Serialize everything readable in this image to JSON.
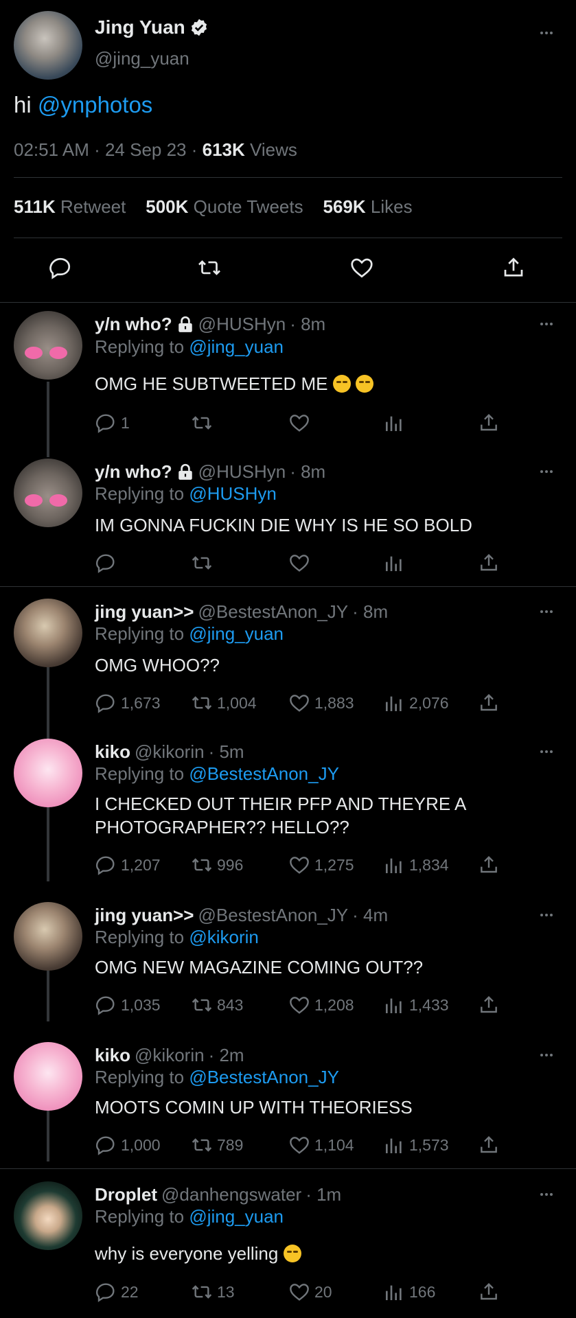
{
  "main_tweet": {
    "name": "Jing Yuan",
    "handle": "@jing_yuan",
    "text_prefix": "hi",
    "mention": "@ynphotos",
    "time": "02:51 AM · 24 Sep 23 ·",
    "views_count": "613K",
    "views_label": "Views",
    "retweets_count": "511K",
    "retweets_label": "Retweet",
    "quotes_count": "500K",
    "quotes_label": "Quote Tweets",
    "likes_count": "569K",
    "likes_label": "Likes"
  },
  "replies": [
    {
      "name": "y/n who?",
      "locked": true,
      "handle": "@HUSHyn",
      "time": "· 8m",
      "reply_prefix": "Replying to",
      "reply_to": "@jing_yuan",
      "lines": [
        "OMG HE SUBTWEETED ME"
      ],
      "emoji_count": 2,
      "replies": "1",
      "retweets": "",
      "likes": "",
      "views": ""
    },
    {
      "name": "y/n who?",
      "locked": true,
      "handle": "@HUSHyn",
      "time": "· 8m",
      "reply_prefix": "Replying to",
      "reply_to": "@HUSHyn",
      "lines": [
        "IM GONNA FUCKIN DIE WHY IS HE SO BOLD"
      ],
      "emoji_count": 0,
      "replies": "",
      "retweets": "",
      "likes": "",
      "views": ""
    },
    {
      "name": "jing yuan>>",
      "locked": false,
      "handle": "@BestestAnon_JY",
      "time": "· 8m",
      "reply_prefix": "Replying to",
      "reply_to": "@jing_yuan",
      "lines": [
        "OMG WHOO??"
      ],
      "emoji_count": 0,
      "replies": "1,673",
      "retweets": "1,004",
      "likes": "1,883",
      "views": "2,076"
    },
    {
      "name": "kiko",
      "locked": false,
      "handle": "@kikorin",
      "time": "· 5m",
      "reply_prefix": "Replying to",
      "reply_to": "@BestestAnon_JY",
      "lines": [
        "I CHECKED OUT THEIR PFP AND THEYRE A",
        "PHOTOGRAPHER?? HELLO??"
      ],
      "emoji_count": 0,
      "replies": "1,207",
      "retweets": "996",
      "likes": "1,275",
      "views": "1,834"
    },
    {
      "name": "jing yuan>>",
      "locked": false,
      "handle": "@BestestAnon_JY",
      "time": "· 4m",
      "reply_prefix": "Replying to",
      "reply_to": "@kikorin",
      "lines": [
        "OMG NEW MAGAZINE COMING OUT??"
      ],
      "emoji_count": 0,
      "replies": "1,035",
      "retweets": "843",
      "likes": "1,208",
      "views": "1,433"
    },
    {
      "name": "kiko",
      "locked": false,
      "handle": "@kikorin",
      "time": "· 2m",
      "reply_prefix": "Replying to",
      "reply_to": "@BestestAnon_JY",
      "lines": [
        "MOOTS COMIN UP WITH THEORIESS"
      ],
      "emoji_count": 0,
      "replies": "1,000",
      "retweets": "789",
      "likes": "1,104",
      "views": "1,573"
    },
    {
      "name": "Droplet",
      "locked": false,
      "handle": "@danhengswater",
      "time": "· 1m",
      "reply_prefix": "Replying to",
      "reply_to": "@jing_yuan",
      "lines": [
        "why is everyone yelling"
      ],
      "emoji_count": 1,
      "replies": "22",
      "retweets": "13",
      "likes": "20",
      "views": "166"
    }
  ],
  "icons": {
    "verified": "verified-badge-icon",
    "lock": "lock-icon",
    "reply": "reply-icon",
    "retweet": "retweet-icon",
    "like": "heart-icon",
    "views": "views-icon",
    "share": "share-icon",
    "more": "more-icon"
  },
  "colors": {
    "accent": "#1d9bf0",
    "background": "#000000",
    "muted": "#71767b",
    "text": "#e7e9ea"
  }
}
